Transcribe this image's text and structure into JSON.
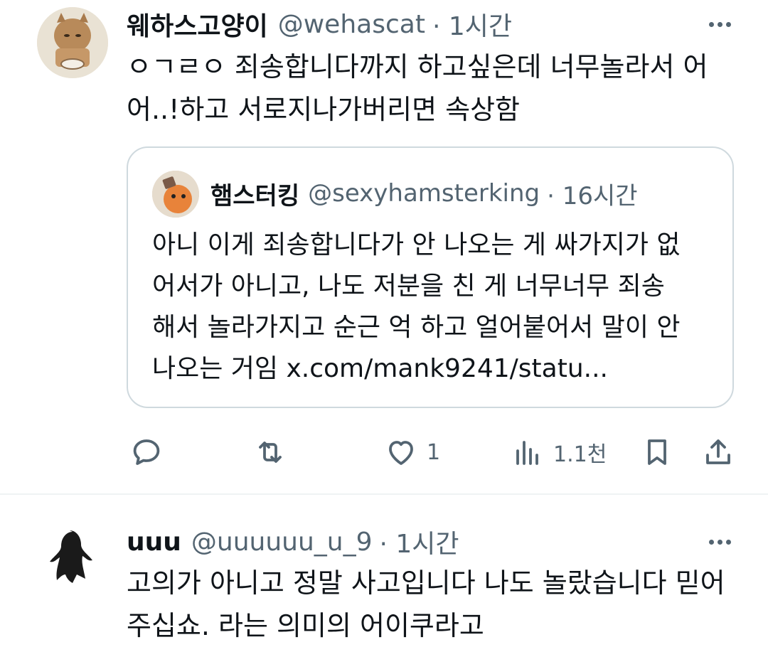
{
  "tweet1": {
    "author_name": "웨하스고양이",
    "handle": "@wehascat",
    "time": "· 1시간",
    "text_lines": [
      "ㅇㄱㄹㅇ 죄송합니다까지 하고싶은데 너무놀라서 어",
      "어..!하고 서로지나가버리면 속상함"
    ],
    "quote": {
      "author_name": "햄스터킹",
      "handle": "@sexyhamsterking",
      "time": "· 16시간",
      "text_lines": [
        "아니 이게 죄송합니다가 안 나오는 게 싸가지가 없",
        "어서가 아니고, 나도 저분을 친 게 너무너무 죄송",
        "해서 놀라가지고 순근 억 하고 얼어붙어서 말이 안",
        "나오는 거임 x.com/mank9241/statu..."
      ]
    },
    "actions": {
      "reply_count": "",
      "retweet_count": "",
      "like_count": "1",
      "views_count": "1.1천"
    }
  },
  "tweet2": {
    "author_name": "uuu",
    "handle": "@uuuuuu_u_9",
    "time": "· 1시간",
    "text_lines": [
      "고의가 아니고 정말 사고입니다 나도 놀랐습니다 믿어",
      "주십쇼. 라는 의미의 어이쿠라고"
    ]
  },
  "icons": {
    "reply": "reply-icon",
    "retweet": "retweet-icon",
    "like": "heart-icon",
    "views": "views-icon",
    "bookmark": "bookmark-icon",
    "share": "share-icon",
    "more": "more-dots-icon"
  },
  "colors": {
    "text": "#0f1419",
    "secondary": "#536471",
    "border": "#cfd9de",
    "divider": "#eff3f4"
  }
}
